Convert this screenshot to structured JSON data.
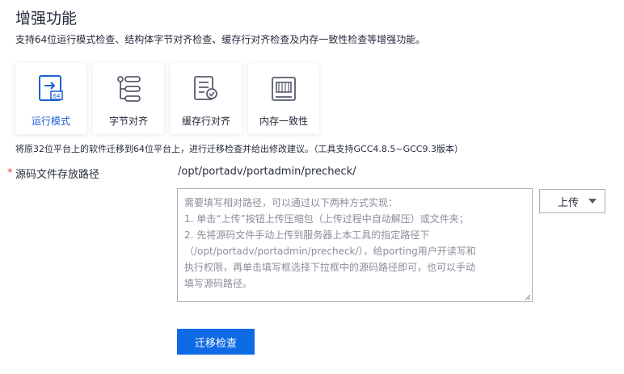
{
  "page": {
    "title": "增强功能",
    "description": "支持64位运行模式检查、结构体字节对齐检查、缓存行对齐检查及内存一致性检查等增强功能。"
  },
  "cards": [
    {
      "label": "运行模式",
      "icon": "arrow-64-icon",
      "active": true
    },
    {
      "label": "字节对齐",
      "icon": "alignment-tree-icon",
      "active": false
    },
    {
      "label": "缓存行对齐",
      "icon": "cache-document-icon",
      "active": false
    },
    {
      "label": "内存一致性",
      "icon": "memory-chip-icon",
      "active": false
    }
  ],
  "hint": "将原32位平台上的软件迁移到64位平台上，进行迁移检查并给出修改建议。（工具支持GCC4.8.5~GCC9.3版本）",
  "form": {
    "required_mark": "*",
    "path_label": "源码文件存放路径",
    "path_value": "/opt/portadv/portadmin/precheck/",
    "textarea_placeholder": "需要填写相对路径，可以通过以下两种方式实现：\n1. 单击“上传”按钮上传压缩包（上传过程中自动解压）或文件夹；\n2. 先将源码文件手动上传到服务器上本工具的指定路径下\n（/opt/portadv/portadmin/precheck/），给porting用户开读写和\n执行权限，再单击填写框选择下拉框中的源码路径即可，也可以手动\n填写源码路径。",
    "upload_label": "上传"
  },
  "actions": {
    "submit_label": "迁移检查"
  },
  "colors": {
    "accent": "#0f6ae6",
    "active_text": "#1e5fd6",
    "required": "#e0413b"
  }
}
